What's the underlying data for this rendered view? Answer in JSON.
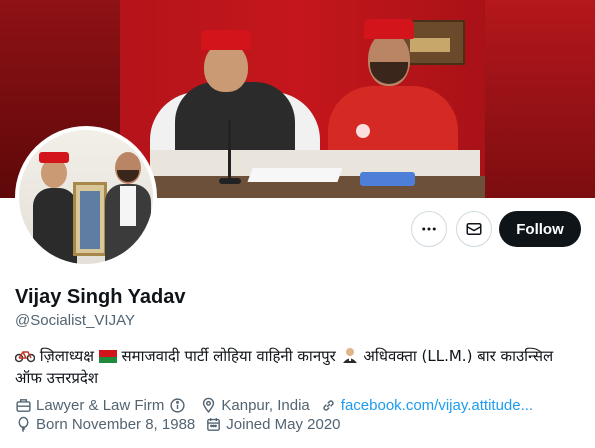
{
  "profile": {
    "display_name": "Vijay Singh Yadav",
    "handle": "@Socialist_VIJAY",
    "bio_part1": "ज़िलाध्यक्ष",
    "bio_part2": "समाजवादी पार्टी लोहिया वाहिनी कानपुर",
    "bio_part3": "अधिवक्ता (LL.M.) बार काउन्सिल ऑफ उत्तरप्रदेश"
  },
  "actions": {
    "follow_label": "Follow"
  },
  "meta": {
    "profession": "Lawyer & Law Firm",
    "location": "Kanpur, India",
    "website": "facebook.com/vijay.attitude...",
    "birthday": "Born November 8, 1988",
    "joined": "Joined May 2020"
  },
  "colors": {
    "text_primary": "#0f1419",
    "text_secondary": "#536471",
    "link": "#1d9bf0",
    "follow_bg": "#0f1419",
    "banner_red": "#c4161c"
  },
  "icons": {
    "more": "more-horizontal-icon",
    "message": "envelope-icon",
    "profession": "briefcase-icon",
    "info": "info-icon",
    "location": "location-pin-icon",
    "website": "link-icon",
    "birthday": "balloon-icon",
    "joined": "calendar-icon"
  }
}
